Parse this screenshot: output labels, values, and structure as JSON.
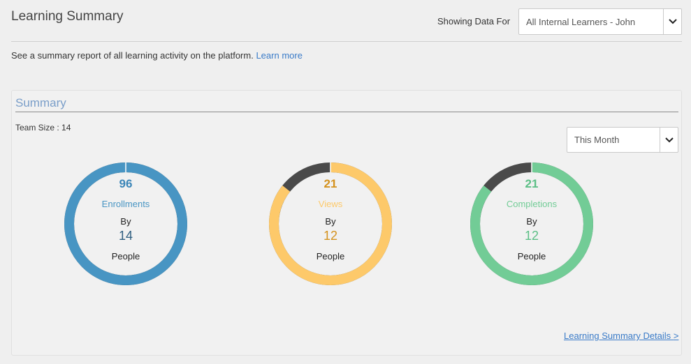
{
  "header": {
    "title": "Learning Summary",
    "showing_label": "Showing Data For",
    "learner_select_value": "All Internal Learners - John"
  },
  "intro": {
    "text": "See a summary report of all learning activity on the platform.",
    "link": "Learn more"
  },
  "summary": {
    "heading": "Summary",
    "team_size": "Team Size : 14",
    "period_select_value": "This Month",
    "details_link": "Learning Summary Details",
    "details_arrow": ">",
    "cards": [
      {
        "id": "enrollments",
        "count": "96",
        "label": "Enrollments",
        "by": "By",
        "people_count": "14",
        "people": "People",
        "color": "#4895c3",
        "count_color": "#3c86b8",
        "people_count_color": "#2f5e80",
        "remainder_color": "#4a4a4a",
        "fraction": 1.0
      },
      {
        "id": "views",
        "count": "21",
        "label": "Views",
        "by": "By",
        "people_count": "12",
        "people": "People",
        "color": "#fdc96a",
        "count_color": "#d4921e",
        "people_count_color": "#d4921e",
        "remainder_color": "#4a4a4a",
        "fraction": 0.857
      },
      {
        "id": "completions",
        "count": "21",
        "label": "Completions",
        "by": "By",
        "people_count": "12",
        "people": "People",
        "color": "#72cc96",
        "count_color": "#5cbf86",
        "people_count_color": "#5cbf86",
        "remainder_color": "#4a4a4a",
        "fraction": 0.857
      }
    ]
  }
}
